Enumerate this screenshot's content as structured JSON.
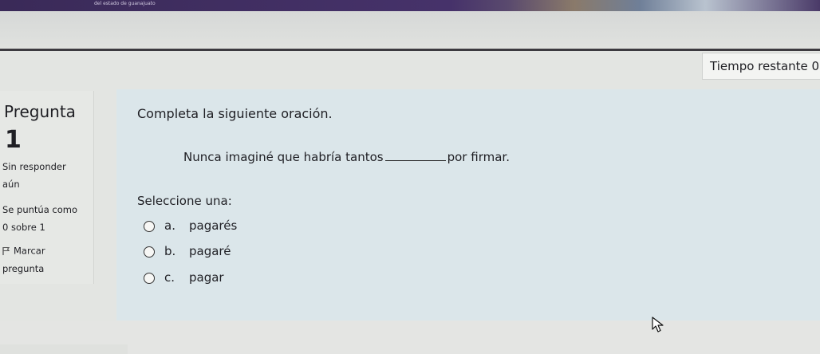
{
  "browser": {
    "top_strip_text": "del estado de guanajuato"
  },
  "header": {
    "timer_text": "Tiempo restante 0"
  },
  "info": {
    "question_label": "Pregunta",
    "question_number": "1",
    "status_line1": "Sin responder",
    "status_line2": "aún",
    "grade_line1": "Se puntúa como",
    "grade_line2": "0 sobre 1",
    "flag_line1": "Marcar",
    "flag_line2": "pregunta"
  },
  "question": {
    "prompt": "Completa la siguiente oración.",
    "sentence_before": "Nunca imaginé que habría tantos",
    "sentence_after": "por firmar.",
    "select_label": "Seleccione una:",
    "options": [
      {
        "letter": "a.",
        "text": "pagarés"
      },
      {
        "letter": "b.",
        "text": "pagaré"
      },
      {
        "letter": "c.",
        "text": "pagar"
      }
    ]
  },
  "icons": {
    "flag": "flag-icon",
    "cursor": "mouse-pointer-icon"
  }
}
